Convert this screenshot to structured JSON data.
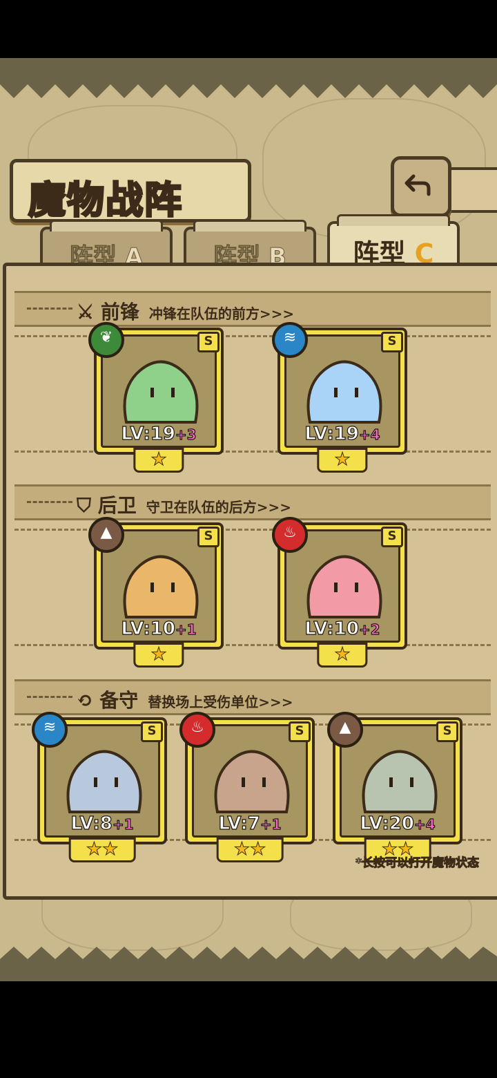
{
  "title": "魔物战阵",
  "tabs": [
    {
      "label_main": "阵型",
      "label_letter": "A",
      "active": false
    },
    {
      "label_main": "阵型",
      "label_letter": "B",
      "active": false
    },
    {
      "label_main": "阵型",
      "label_letter": "C",
      "active": true
    }
  ],
  "sections": {
    "front": {
      "title": "前锋",
      "subtitle": "冲锋在队伍的前方>>>"
    },
    "back": {
      "title": "后卫",
      "subtitle": "守卫在队伍的后方>>>"
    },
    "reserve": {
      "title": "备守",
      "subtitle": "替换场上受伤单位>>>"
    }
  },
  "rank_label": "S",
  "level_prefix": "LV:",
  "units": {
    "front": [
      {
        "element": "leaf",
        "level": "19",
        "bonus": "+3",
        "stars": "★",
        "color": "#8fd08a"
      },
      {
        "element": "water",
        "level": "19",
        "bonus": "+4",
        "stars": "★",
        "color": "#a9d3f7"
      }
    ],
    "back": [
      {
        "element": "earth",
        "level": "10",
        "bonus": "+1",
        "stars": "★",
        "color": "#e9b66a"
      },
      {
        "element": "fire",
        "level": "10",
        "bonus": "+2",
        "stars": "★",
        "color": "#f29aa6"
      }
    ],
    "reserve": [
      {
        "element": "water",
        "level": "8",
        "bonus": "+1",
        "stars": "★★",
        "color": "#b8c9dd"
      },
      {
        "element": "fire",
        "level": "7",
        "bonus": "+1",
        "stars": "★★",
        "color": "#c9a48c"
      },
      {
        "element": "earth",
        "level": "20",
        "bonus": "+4",
        "stars": "★★",
        "color": "#b8c4b0"
      }
    ]
  },
  "element_icons": {
    "leaf": "❦",
    "water": "≋",
    "earth": "▲",
    "fire": "♨"
  },
  "element_colors": {
    "leaf": "#3d8a3a",
    "water": "#2a86c6",
    "earth": "#7a5a45",
    "fire": "#d42c2c"
  },
  "hint": "*长按可以打开魔物状态"
}
